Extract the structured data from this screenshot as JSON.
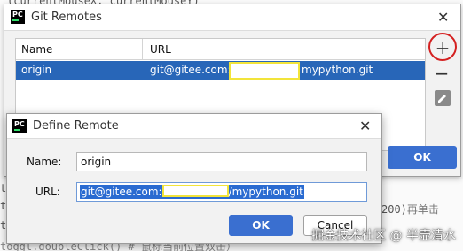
{
  "editor": {
    "line_top": "(currentMouseX, currentMouseY)",
    "line_a": "t",
    "line_b": "t",
    "line_c_code": "200)",
    "line_c_comment": "再单击",
    "line_d": "toggl.doubleClick()  # 鼠标当前位置双击）",
    "line_e": "t"
  },
  "git_remotes": {
    "title": "Git Remotes",
    "columns": {
      "name": "Name",
      "url": "URL"
    },
    "rows": [
      {
        "name": "origin",
        "url_prefix": "git@gitee.com:",
        "url_suffix": "mypython.git",
        "selected": true
      }
    ],
    "tools": {
      "add": "+",
      "remove": "−",
      "edit": "edit"
    },
    "ok_label": "OK",
    "close_glyph": "✕"
  },
  "define_remote": {
    "title": "Define Remote",
    "name_label": "Name:",
    "name_value": "origin",
    "url_label": "URL:",
    "url_prefix": "git@gitee.com:",
    "url_suffix": "/mypython.git",
    "ok_label": "OK",
    "cancel_label": "Cancel",
    "close_glyph": "✕"
  },
  "app_icon_text": "PC",
  "watermark": "掘金技术社区 @ 半壶清水",
  "colors": {
    "selection": "#2866b8",
    "primary_button": "#3a6fd0",
    "highlight_ring": "#d42020",
    "mask_border": "#f2e43a"
  }
}
